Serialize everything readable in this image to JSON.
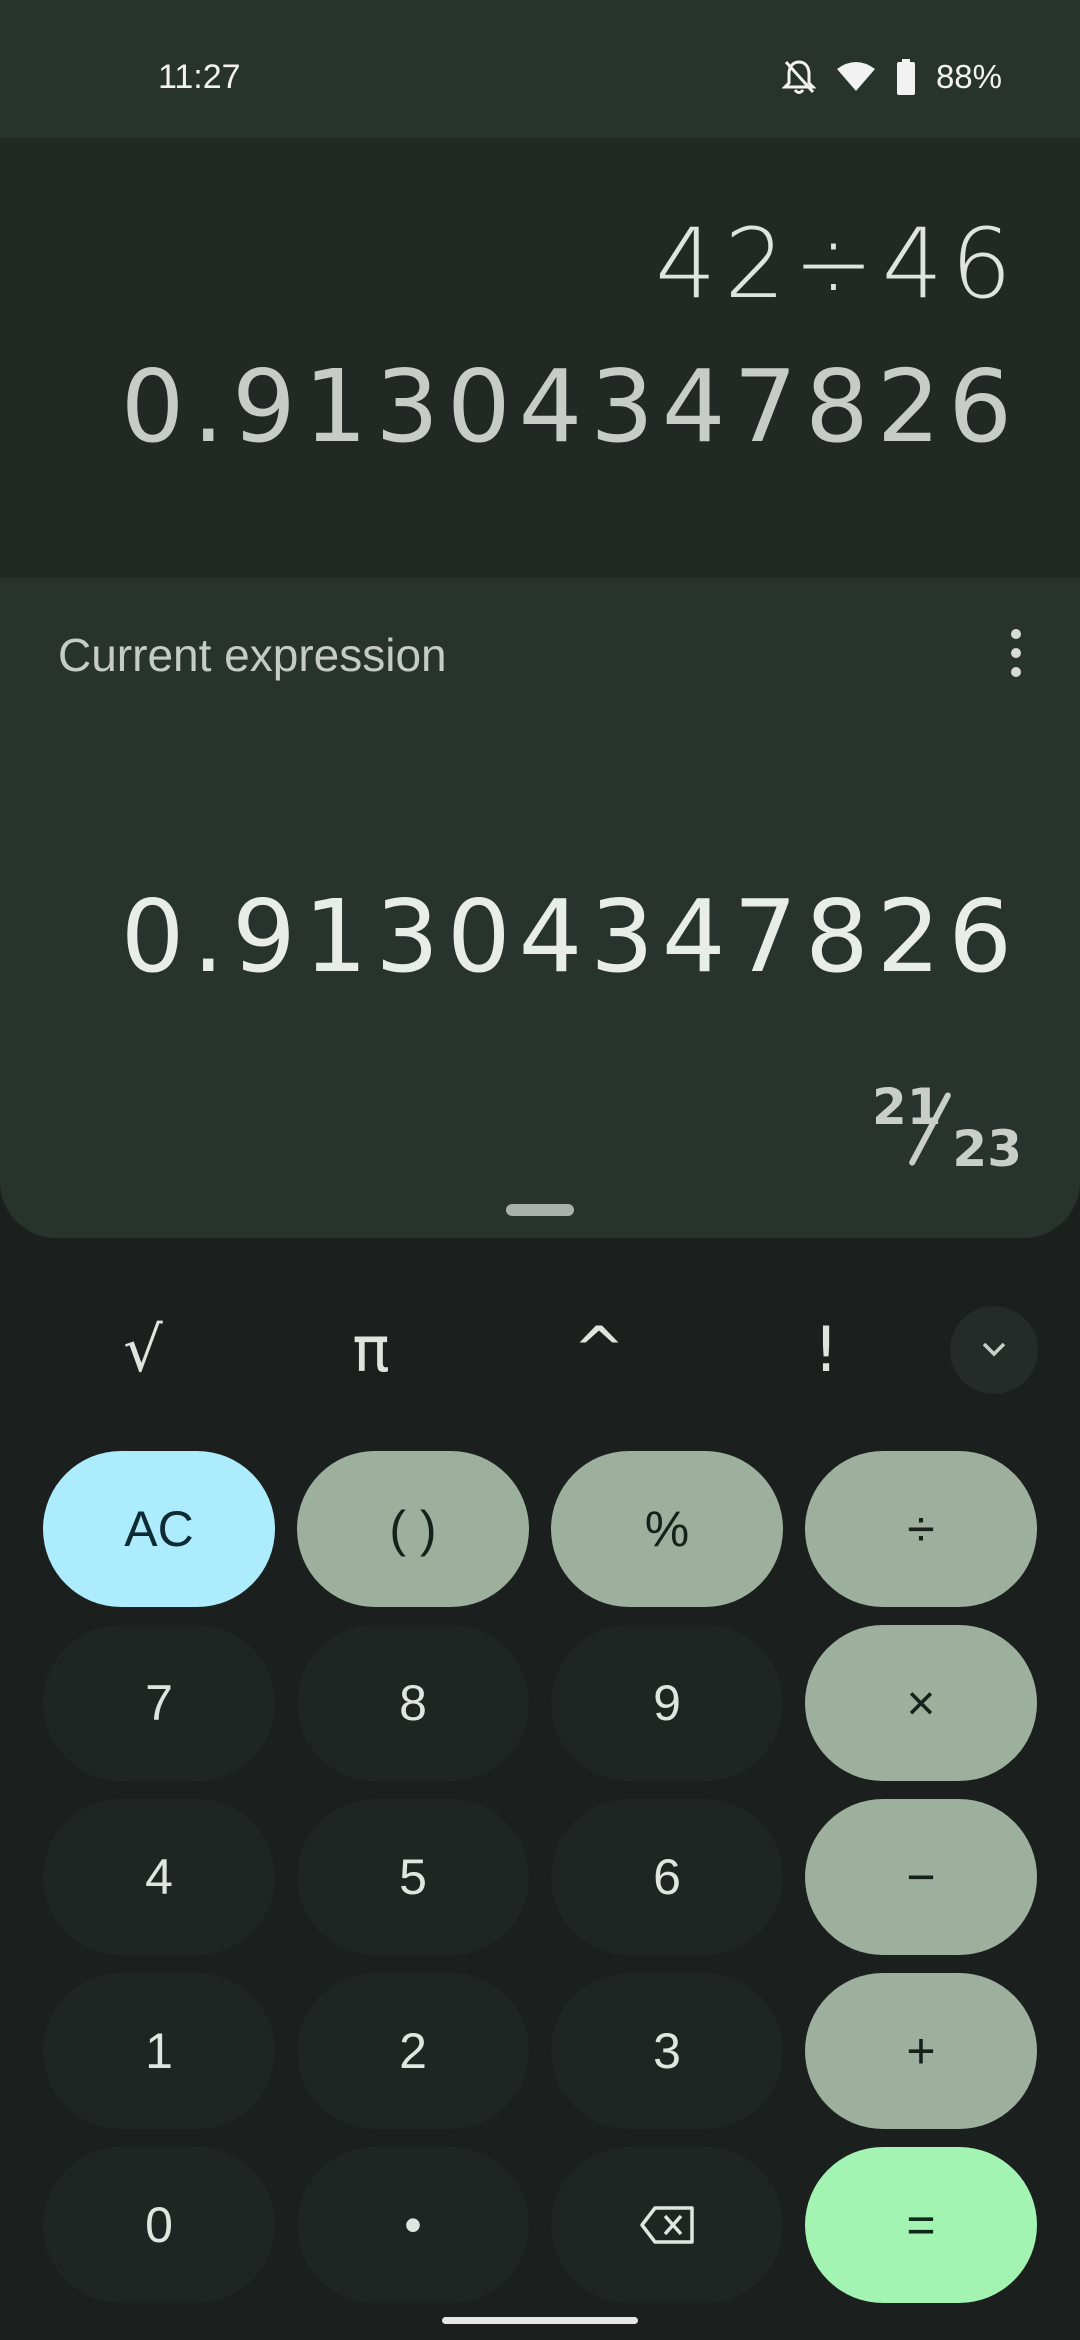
{
  "status": {
    "time": "11:27",
    "battery": "88%",
    "icons": [
      "bell-off-icon",
      "wifi-icon",
      "battery-icon"
    ]
  },
  "history": {
    "expression": "42÷46",
    "result": "0.91304347826"
  },
  "current": {
    "label": "Current expression",
    "value": "0.91304347826",
    "fraction_numerator": "21",
    "fraction_denominator": "23"
  },
  "scientific": {
    "keys": [
      "√",
      "π",
      "^",
      "!"
    ]
  },
  "keypad": {
    "row1": [
      "AC",
      "( )",
      "%",
      "÷"
    ],
    "row2": [
      "7",
      "8",
      "9",
      "×"
    ],
    "row3": [
      "4",
      "5",
      "6",
      "−"
    ],
    "row4": [
      "1",
      "2",
      "3",
      "+"
    ],
    "row5": [
      "0",
      "•",
      "backspace",
      "="
    ]
  },
  "colors": {
    "clear_key": "#acecfc",
    "operator_key": "#9db09d",
    "equals_key": "#a3f4b3",
    "digit_key": "#1f2522"
  }
}
